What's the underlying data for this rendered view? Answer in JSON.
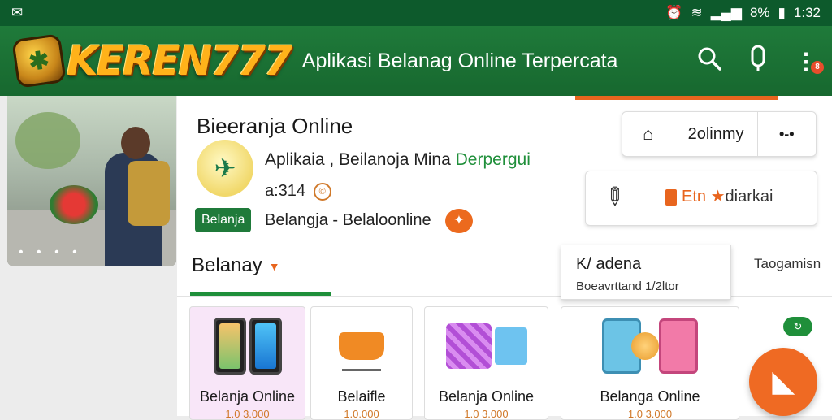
{
  "status_bar": {
    "left_icon": "gmail-icon",
    "battery": "8%",
    "time": "1:32"
  },
  "header": {
    "logo_text": "KEREN777",
    "tagline": "Aplikasi Belanag Online Terpercata",
    "icons": [
      "search-icon",
      "mic-icon",
      "more-icon"
    ],
    "notification_badge": "8"
  },
  "banner": {
    "dots": "• • • •"
  },
  "app": {
    "title": "Bieeranja Online",
    "subtitle_prefix": "Aplikaia ,  Beilanoja Mina ",
    "subtitle_highlight": "Derpergui",
    "rating": "a:314",
    "chip": "Belanja",
    "tags": "Belangja  - Belaloonline"
  },
  "actions": {
    "button_group_label": "2olinmy",
    "action_label_orange": "Etn",
    "action_label_dark": "diarkai"
  },
  "tabs": {
    "active": "Belanay",
    "dropdown_title": "K/ adena",
    "dropdown_sub": "Boeavrttand 1/2ltor",
    "right": "Taogamisn"
  },
  "cards": [
    {
      "title": "Belanja Online",
      "price": "1.0 3.000"
    },
    {
      "title": "Belaifle",
      "price": "1.0.000"
    },
    {
      "title": "Belanja Online",
      "price": "1.0 3.000"
    },
    {
      "title": "Belanga Online",
      "price": "1.0 3.000"
    }
  ],
  "fab": {
    "icon": "bag-icon"
  },
  "colors": {
    "brand_green": "#1f7a3a",
    "accent_orange": "#e8651e",
    "logo_gold": "#ffb21a"
  }
}
